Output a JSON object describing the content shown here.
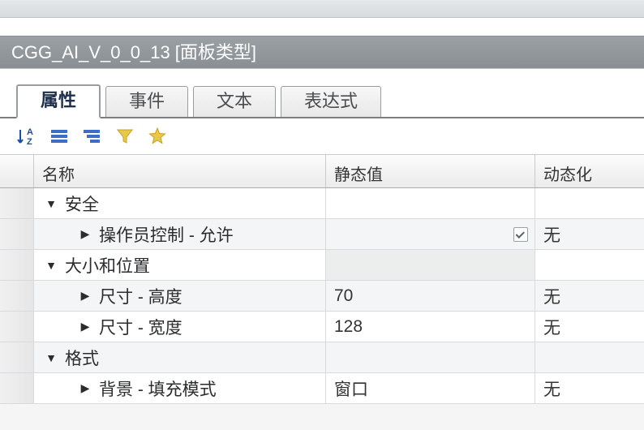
{
  "window": {
    "title": "CGG_AI_V_0_0_13  [面板类型]"
  },
  "tabs": [
    {
      "label": "属性",
      "active": true
    },
    {
      "label": "事件",
      "active": false
    },
    {
      "label": "文本",
      "active": false
    },
    {
      "label": "表达式",
      "active": false
    }
  ],
  "columns": {
    "name": "名称",
    "static_value": "静态值",
    "dynamic": "动态化"
  },
  "toolbar_icons": {
    "sort": "sort-alpha-icon",
    "expand": "expand-all-icon",
    "collapse": "collapse-all-icon",
    "filter": "filter-icon",
    "favorite": "star-icon"
  },
  "groups": [
    {
      "label": "安全",
      "expanded": true,
      "items": [
        {
          "label": "操作员控制 - 允许",
          "value_type": "checkbox",
          "checked": true,
          "dynamic": "无"
        }
      ]
    },
    {
      "label": "大小和位置",
      "expanded": true,
      "shaded_header_value": true,
      "items": [
        {
          "label": "尺寸 - 高度",
          "value_type": "text",
          "value": "70",
          "dynamic": "无"
        },
        {
          "label": "尺寸 - 宽度",
          "value_type": "text",
          "value": "128",
          "dynamic": "无"
        }
      ]
    },
    {
      "label": "格式",
      "expanded": true,
      "items": [
        {
          "label": "背景 - 填充模式",
          "value_type": "text",
          "value": "窗口",
          "dynamic": "无"
        }
      ]
    }
  ]
}
